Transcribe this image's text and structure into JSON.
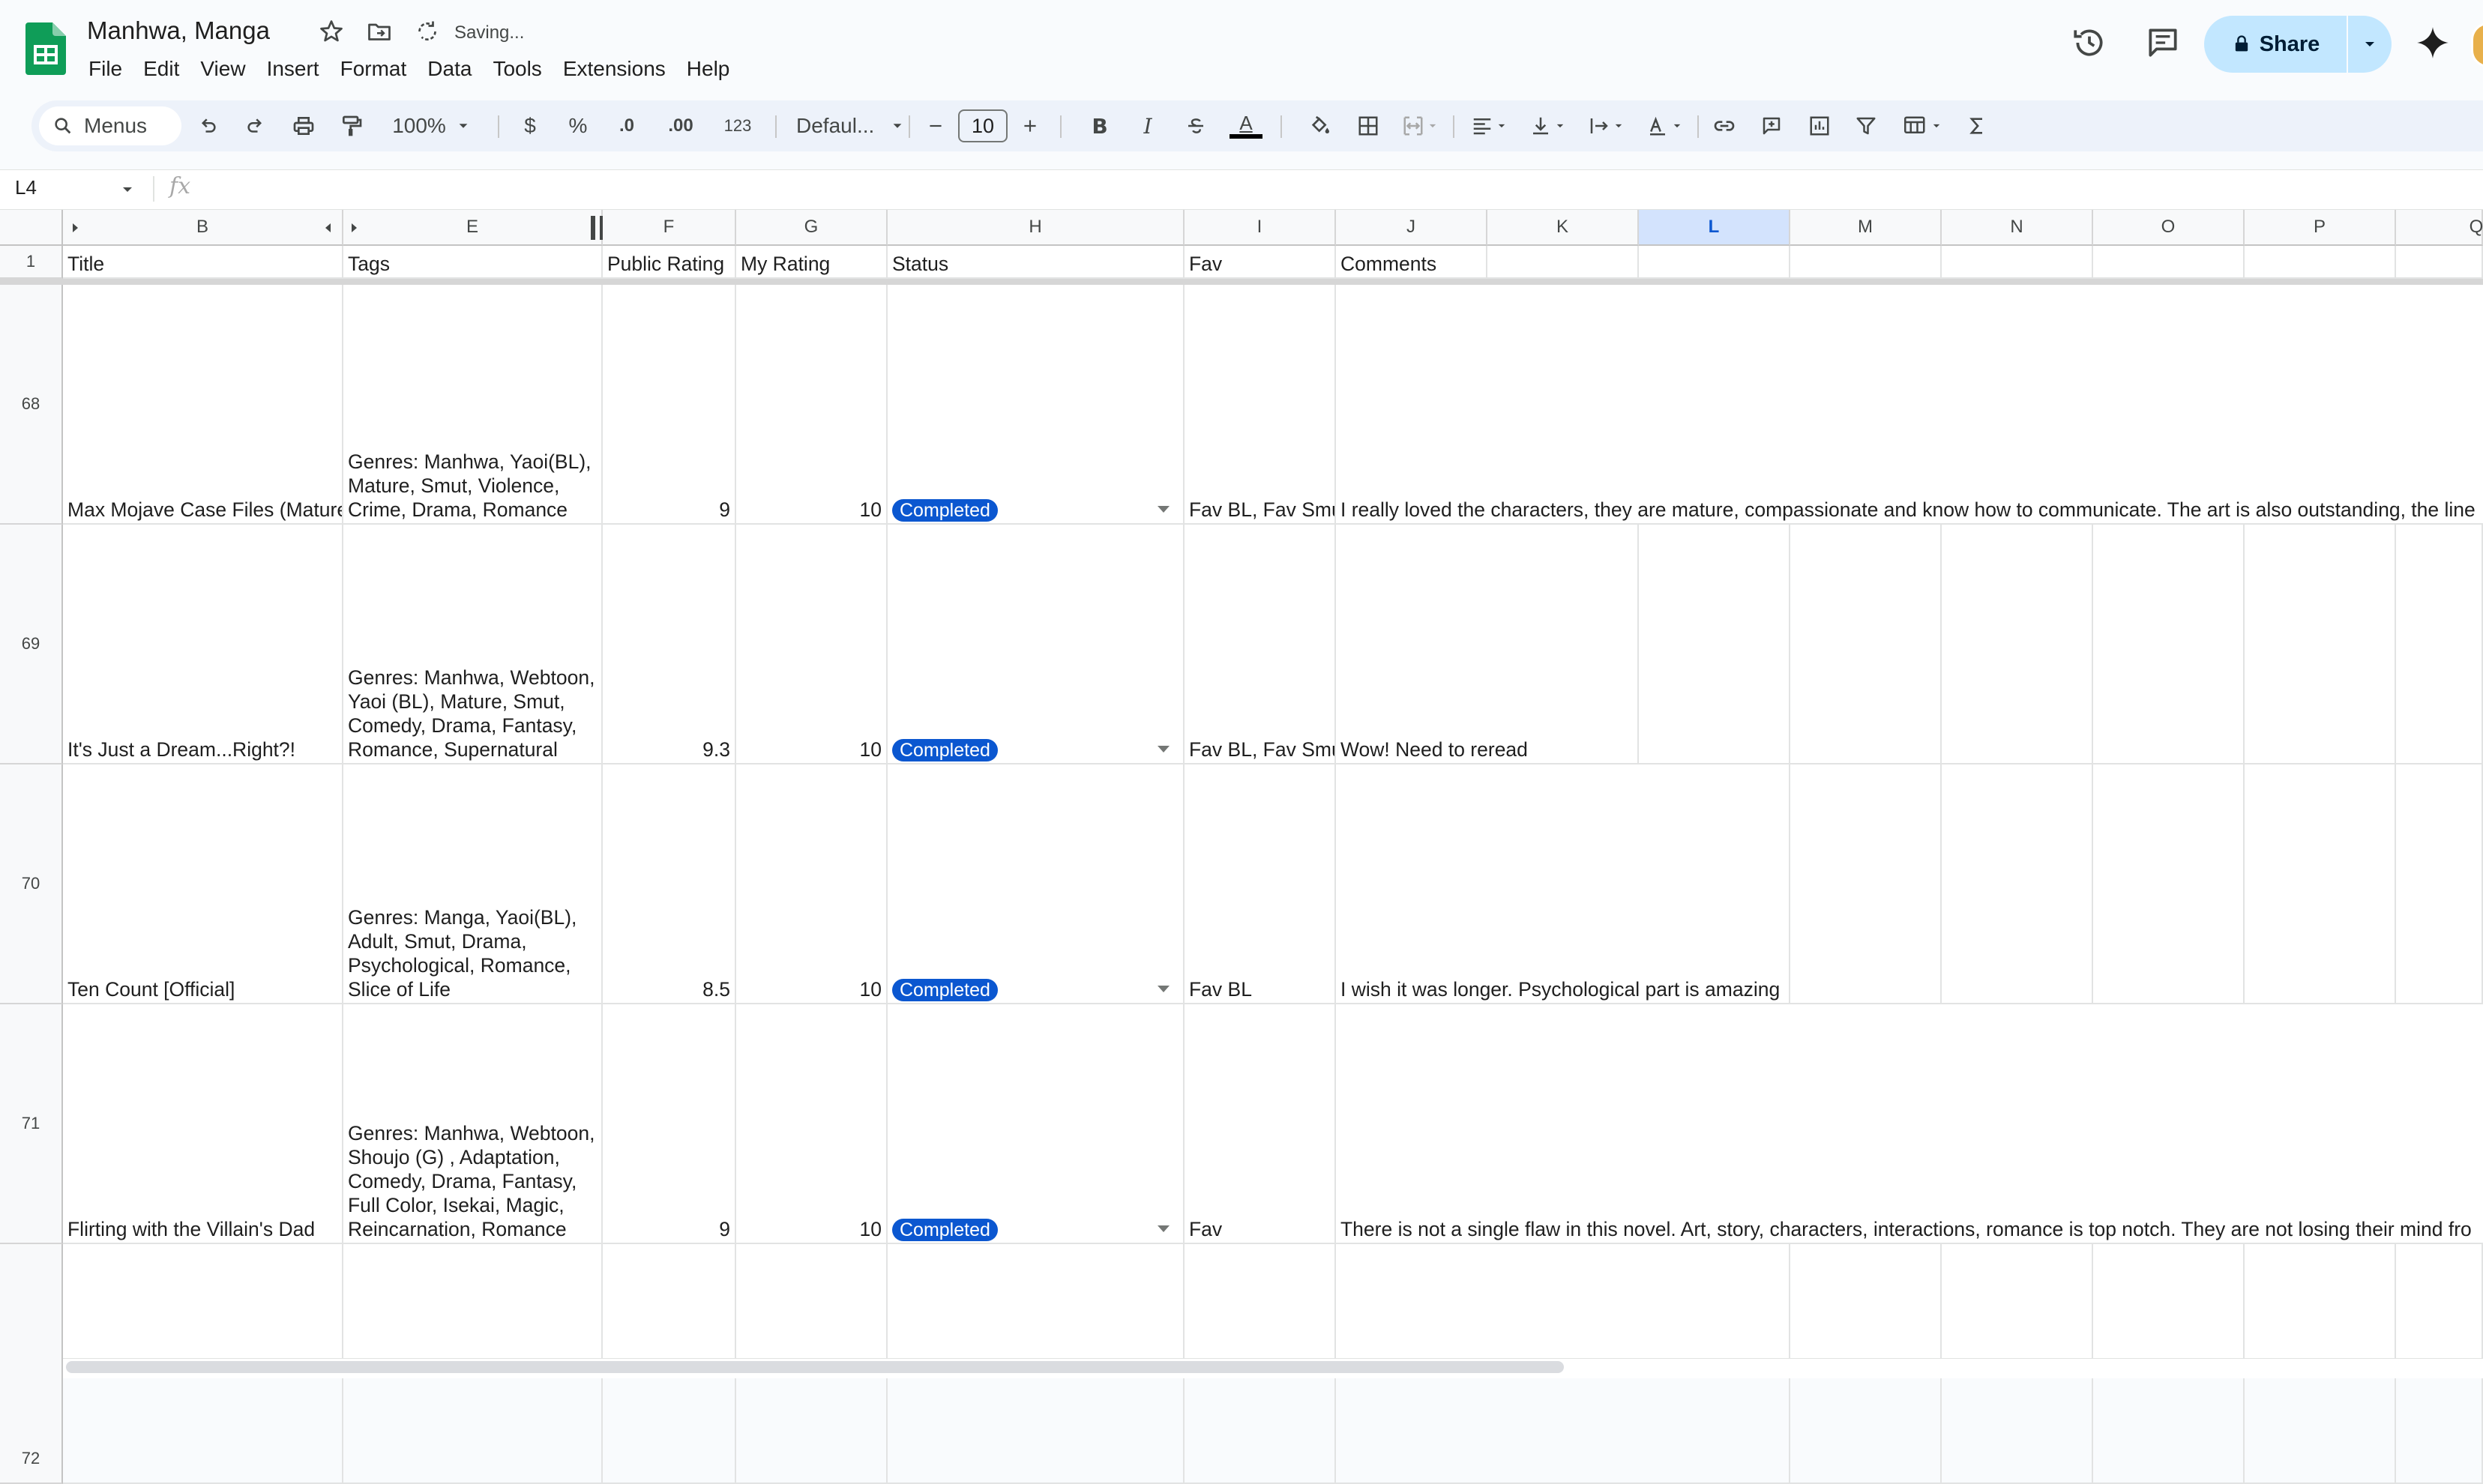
{
  "header": {
    "doc_title": "Manhwa, Manga",
    "save_status": "Saving...",
    "share_label": "Share"
  },
  "menu": [
    "File",
    "Edit",
    "View",
    "Insert",
    "Format",
    "Data",
    "Tools",
    "Extensions",
    "Help"
  ],
  "toolbar": {
    "search_label": "Menus",
    "zoom": "100%",
    "currency": "$",
    "percent": "%",
    "dec_decrease": ".0",
    "dec_increase": ".00",
    "number_format": "123",
    "font": "Defaul...",
    "font_size": "10",
    "bold": "B",
    "italic": "I",
    "text_color": "A"
  },
  "formula_bar": {
    "cell_ref": "L4",
    "fx": "fx"
  },
  "columns": [
    "B",
    "E",
    "F",
    "G",
    "H",
    "I",
    "J",
    "K",
    "L",
    "M",
    "N",
    "O",
    "P",
    "Q"
  ],
  "header_row": {
    "row_num": "1",
    "title": "Title",
    "tags": "Tags",
    "public_rating": "Public Rating",
    "my_rating": "My Rating",
    "status": "Status",
    "fav": "Fav",
    "comments": "Comments"
  },
  "rows": [
    {
      "num": "68",
      "title": "Max Mojave Case Files (Mature)",
      "tags": [
        "Genres: Manhwa, Yaoi(BL),",
        "Mature, Smut, Violence,",
        "Crime, Drama, Romance"
      ],
      "public_rating": "9",
      "my_rating": "10",
      "status": "Completed",
      "fav": "Fav BL, Fav Smut",
      "comments": "I really loved the characters, they are mature, compassionate and know how to communicate. The art is also outstanding, the line"
    },
    {
      "num": "69",
      "title": "It's Just a Dream...Right?!",
      "tags": [
        "Genres: Manhwa, Webtoon,",
        "Yaoi (BL), Mature, Smut,",
        "Comedy, Drama, Fantasy,",
        "Romance, Supernatural"
      ],
      "public_rating": "9.3",
      "my_rating": "10",
      "status": "Completed",
      "fav": "Fav BL, Fav Smut",
      "comments": "Wow! Need to reread"
    },
    {
      "num": "70",
      "title": "Ten Count [Official]",
      "tags": [
        "Genres: Manga, Yaoi(BL),",
        "Adult, Smut, Drama,",
        "Psychological, Romance,",
        "Slice of Life"
      ],
      "public_rating": "8.5",
      "my_rating": "10",
      "status": "Completed",
      "fav": "Fav BL",
      "comments": "I wish it was longer. Psychological part is amazing"
    },
    {
      "num": "71",
      "title": "Flirting with the Villain's Dad",
      "tags": [
        "Genres: Manhwa, Webtoon,",
        "Shoujo (G) , Adaptation,",
        "Comedy, Drama, Fantasy,",
        "Full Color, Isekai, Magic,",
        "Reincarnation, Romance"
      ],
      "public_rating": "9",
      "my_rating": "10",
      "status": "Completed",
      "fav": "Fav",
      "comments": "There is not a single flaw in this novel. Art, story, characters, interactions, romance is top notch. They are not losing their mind fro"
    },
    {
      "num": "72",
      "title": "",
      "tags": [],
      "public_rating": "",
      "my_rating": "",
      "status": "",
      "fav": "",
      "comments": ""
    }
  ],
  "colors": {
    "chip": "#0b57d0",
    "share_bg": "#c2e7ff",
    "selected_col": "#d3e3fd",
    "sheets_green": "#0f9d58"
  }
}
